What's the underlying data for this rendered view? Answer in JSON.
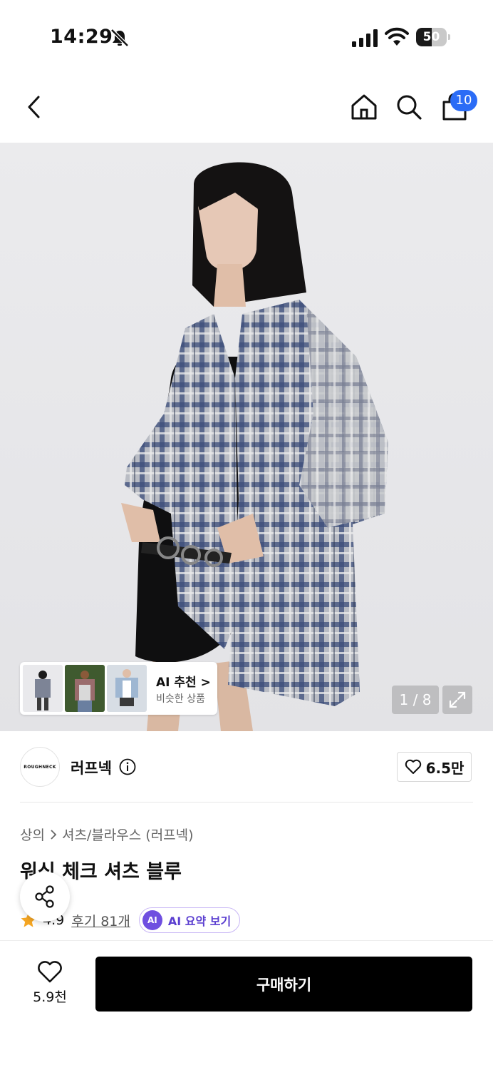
{
  "status_bar": {
    "time": "14:29",
    "battery": "50",
    "battery_fraction": 0.5,
    "icons": [
      "bell-muted-icon",
      "signal-icon",
      "wifi-icon",
      "battery-icon"
    ]
  },
  "nav": {
    "icons": [
      "chevron-left-icon",
      "home-icon",
      "search-icon",
      "shopping-bag-icon"
    ],
    "cart_badge": "10"
  },
  "gallery": {
    "page_indicator": "1 / 8",
    "expand_icon": "expand-icon"
  },
  "ai_recommend": {
    "title": "AI 추천 >",
    "subtitle": "비슷한 상품"
  },
  "brand": {
    "logo_text": "ROUGHNECK",
    "name": "러프넥",
    "likes": "6.5만"
  },
  "product": {
    "breadcrumb": [
      "상의",
      "셔츠/블라우스 (러프넥)"
    ],
    "title": "워싱 체크 셔츠 블루",
    "rating": "4.9",
    "reviews": "후기 81개",
    "ai_summary_badge": "AI",
    "ai_summary_label": "AI 요약 보기"
  },
  "bottom_bar": {
    "wish_count": "5.9천",
    "buy_label": "구매하기"
  },
  "colors": {
    "badge_blue": "#2b6cf6",
    "ai_purple": "#6f4fe0",
    "star_orange": "#f5a623",
    "buy_black": "#000000"
  }
}
